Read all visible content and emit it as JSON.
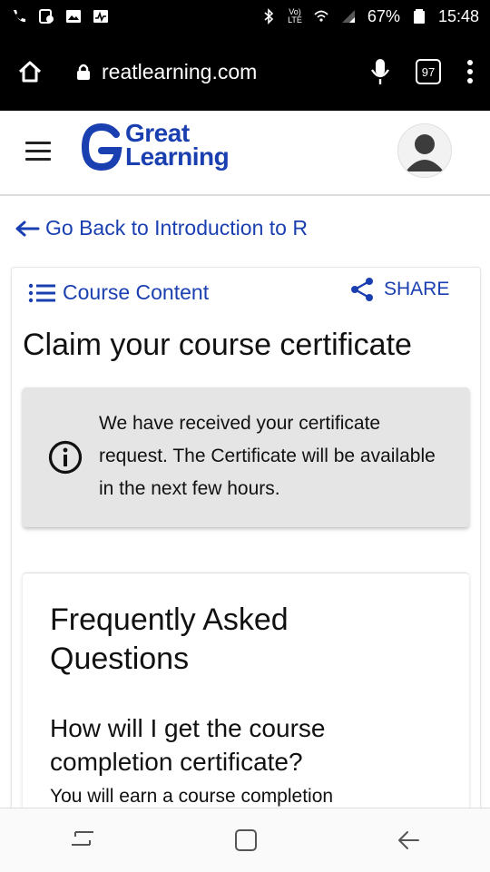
{
  "status_bar": {
    "battery": "67%",
    "time": "15:48",
    "network_label_top": "Vo)",
    "network_label_bottom": "LTE"
  },
  "browser": {
    "url": "realearning.com",
    "url_display": "reatlearning.com",
    "tab_count": "97"
  },
  "header": {
    "logo_line1": "Great",
    "logo_line2": "Learning"
  },
  "page": {
    "go_back": "Go Back to Introduction to R",
    "course_content": "Course Content",
    "share": "SHARE",
    "title": "Claim your course certificate",
    "notice": "We have received your certificate request. The Certificate will be available in the next few hours.",
    "faq_title": "Frequently Asked Questions",
    "faq_question": "How will I get the course completion certificate?",
    "faq_answer": "You will earn a course completion"
  },
  "colors": {
    "brand_blue": "#1a3fb0",
    "notice_bg": "#e5e5e5"
  },
  "icons": [
    "home-icon",
    "lock-icon",
    "mic-icon",
    "tabs-icon",
    "more-icon",
    "hamburger-icon",
    "avatar-icon",
    "back-arrow-icon",
    "list-icon",
    "share-icon",
    "info-icon",
    "recent-apps-icon",
    "home-button-icon",
    "back-button-icon"
  ]
}
